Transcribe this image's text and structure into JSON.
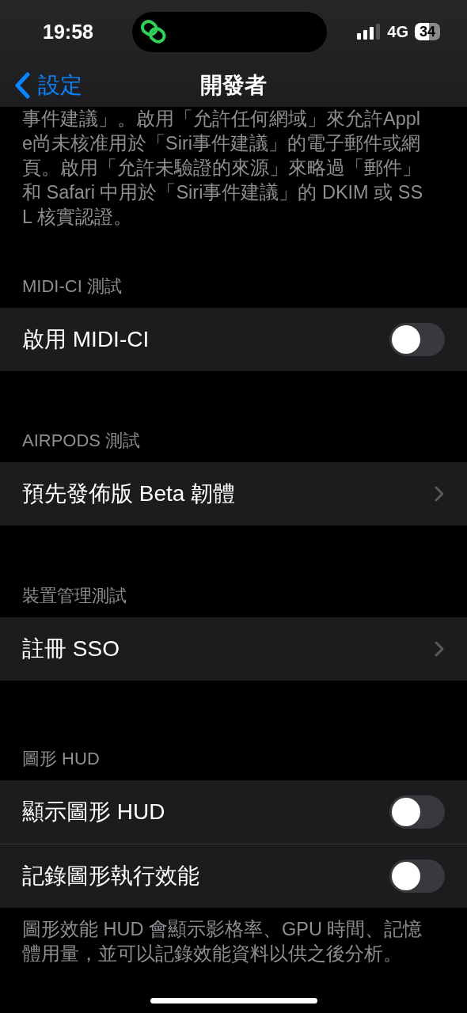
{
  "status_bar": {
    "time": "19:58",
    "network": "4G",
    "battery": "34"
  },
  "nav": {
    "back": "設定",
    "title": "開發者"
  },
  "intro": "事件建議」。啟用「允許任何網域」來允許Apple尚未核准用於「Siri事件建議」的電子郵件或網頁。啟用「允許未驗證的來源」來略過「郵件」和 Safari 中用於「Siri事件建議」的 DKIM 或 SSL 核實認證。",
  "sections": [
    {
      "header": "MIDI-CI 測試",
      "rows": [
        {
          "kind": "toggle",
          "label": "啟用 MIDI-CI",
          "on": false
        }
      ]
    },
    {
      "header": "AIRPODS 測試",
      "rows": [
        {
          "kind": "link",
          "label": "預先發佈版 Beta 韌體"
        }
      ]
    },
    {
      "header": "裝置管理測試",
      "rows": [
        {
          "kind": "link",
          "label": "註冊 SSO"
        }
      ]
    },
    {
      "header": "圖形 HUD",
      "rows": [
        {
          "kind": "toggle",
          "label": "顯示圖形 HUD",
          "on": false
        },
        {
          "kind": "toggle",
          "label": "記錄圖形執行效能",
          "on": false
        }
      ],
      "footer": "圖形效能 HUD 會顯示影格率、GPU 時間、記憶體用量，並可以記錄效能資料以供之後分析。"
    }
  ]
}
